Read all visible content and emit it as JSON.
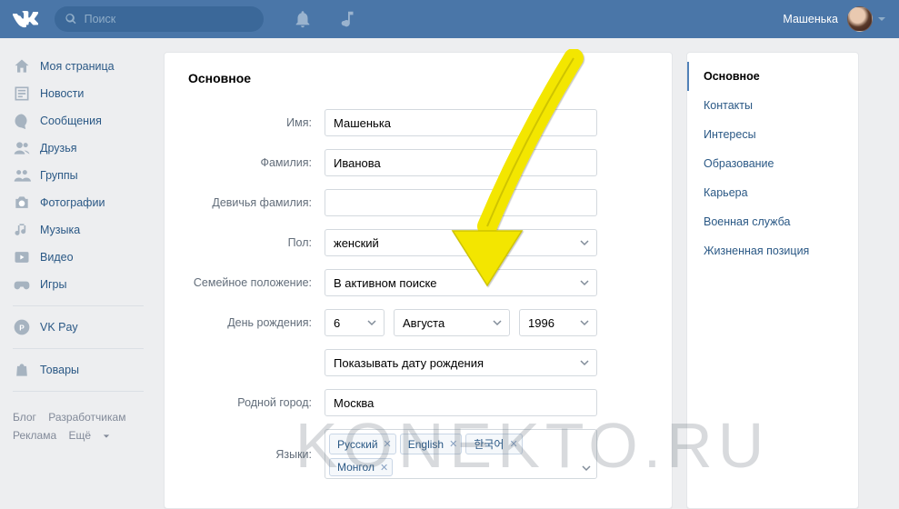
{
  "header": {
    "search_placeholder": "Поиск",
    "username": "Машенька"
  },
  "nav": {
    "items": [
      "Моя страница",
      "Новости",
      "Сообщения",
      "Друзья",
      "Группы",
      "Фотографии",
      "Музыка",
      "Видео",
      "Игры"
    ],
    "vkpay": "VK Pay",
    "goods": "Товары",
    "footer": {
      "blog": "Блог",
      "dev": "Разработчикам",
      "ads": "Реклама",
      "more": "Ещё"
    }
  },
  "edit": {
    "title": "Основное",
    "labels": {
      "name": "Имя:",
      "surname": "Фамилия:",
      "maiden": "Девичья фамилия:",
      "sex": "Пол:",
      "relationship": "Семейное положение:",
      "birthday": "День рождения:",
      "hometown": "Родной город:",
      "languages": "Языки:"
    },
    "values": {
      "name": "Машенька",
      "surname": "Иванова",
      "maiden": "",
      "sex": "женский",
      "relationship": "В активном поиске",
      "bday_day": "6",
      "bday_month": "Августа",
      "bday_year": "1996",
      "bday_visibility": "Показывать дату рождения",
      "hometown": "Москва"
    },
    "languages": [
      "Русский",
      "English",
      "한국어",
      "Монгол"
    ]
  },
  "tabs": [
    "Основное",
    "Контакты",
    "Интересы",
    "Образование",
    "Карьера",
    "Военная служба",
    "Жизненная позиция"
  ],
  "watermark": "KONEKTO.RU"
}
